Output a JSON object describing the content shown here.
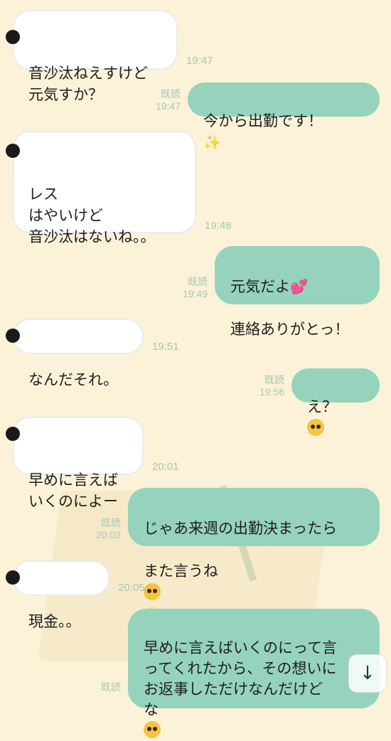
{
  "messages": [
    {
      "side": "in",
      "text": "音沙汰ねえすけど\n元気すか？",
      "time": "19:47"
    },
    {
      "side": "out",
      "text": "今から出勤です！",
      "read": "既読",
      "time": "19:47",
      "emoji": "sparkles-icon"
    },
    {
      "side": "in",
      "text": "レス\nはやいけど\n音沙汰はないね。。",
      "time": "19:48"
    },
    {
      "side": "out",
      "text": "元気だよ",
      "text2": "連絡ありがとっ！",
      "read": "既読",
      "time": "19:49",
      "emoji": "two-hearts-icon"
    },
    {
      "side": "in",
      "text": "なんだそれ。",
      "time": "19:51"
    },
    {
      "side": "out",
      "text": "え？",
      "read": "既読",
      "time": "19:56",
      "emoji": "pleading-face-icon"
    },
    {
      "side": "in",
      "text": "早めに言えば\nいくのによー",
      "time": "20:01"
    },
    {
      "side": "out",
      "text": "じゃあ来週の出勤決まったら",
      "text2": "また言うね",
      "read": "既読",
      "time": "20:02",
      "emoji": "winking-face-icon",
      "emoji2": "sparkles-icon"
    },
    {
      "side": "in",
      "text": "現金。。",
      "time": "20:05"
    },
    {
      "side": "out",
      "text": "早めに言えばいくのにって言\nってくれたから、その想いに\nお返事しただけなんだけど\nな",
      "read": "既読",
      "emoji": "pleading-face-icon"
    }
  ],
  "glyphs": {
    "sparkle": "✨",
    "heart": "💕",
    "arrow_down": "↓"
  }
}
